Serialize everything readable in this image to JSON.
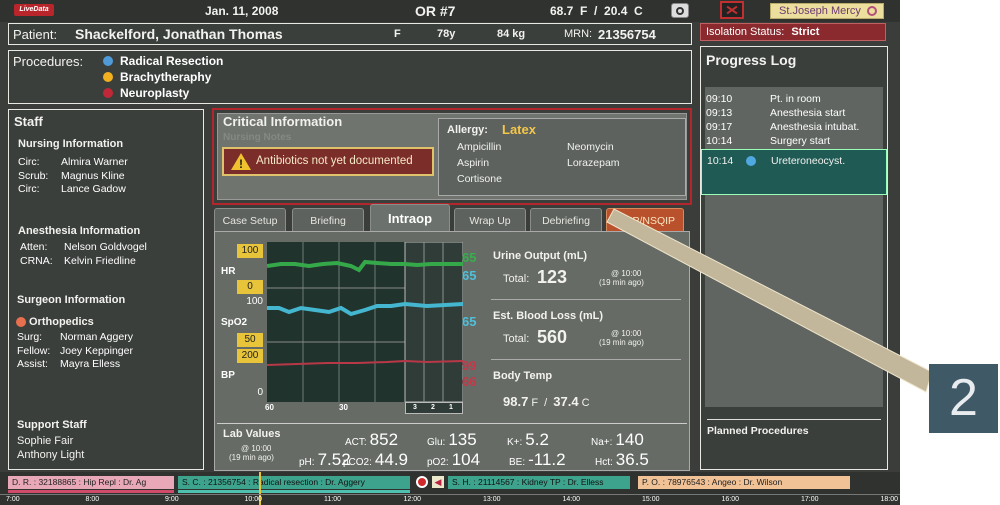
{
  "header": {
    "logo": "LiveData",
    "date": "Jan. 11, 2008",
    "room": "OR #7",
    "temp": "68.7  F  /  20.4  C",
    "hospital": "St.Joseph Mercy"
  },
  "patient": {
    "label": "Patient:",
    "name": "Shackelford, Jonathan Thomas",
    "sex": "F",
    "age": "78y",
    "weight": "84 kg",
    "mrn_label": "MRN:",
    "mrn": "21356754"
  },
  "isolation": {
    "label": "Isolation Status:",
    "value": "Strict"
  },
  "procedures": {
    "label": "Procedures:",
    "items": [
      {
        "name": "Radical Resection",
        "color": "#4f9bd8"
      },
      {
        "name": "Brachytheraphy",
        "color": "#f0b020"
      },
      {
        "name": "Neuroplasty",
        "color": "#c02838"
      }
    ]
  },
  "staff": {
    "title": "Staff",
    "nursing": {
      "title": "Nursing Information",
      "rows": [
        [
          "Circ:",
          "Almira Warner"
        ],
        [
          "Scrub:",
          "Magnus Kline"
        ],
        [
          "Circ:",
          "Lance Gadow"
        ]
      ]
    },
    "anesthesia": {
      "title": "Anesthesia Information",
      "rows": [
        [
          "Atten:",
          "Nelson Goldvogel"
        ],
        [
          "CRNA:",
          "Kelvin Friedline"
        ]
      ]
    },
    "surgeon": {
      "title": "Surgeon Information",
      "specialty": "Orthopedics",
      "rows": [
        [
          "Surg:",
          "Norman Aggery"
        ],
        [
          "Fellow:",
          "Joey Keppinger"
        ],
        [
          "Assist:",
          "Mayra Elless"
        ]
      ]
    },
    "support": {
      "title": "Support Staff",
      "names": [
        "Sophie Fair",
        "Anthony Light"
      ]
    }
  },
  "critical": {
    "title": "Critical Information",
    "nursing_notes": "Nursing Notes",
    "alert": "Antibiotics not yet documented",
    "allergy_label": "Allergy:",
    "allergy_value": "Latex",
    "allergies": [
      "Ampicillin",
      "Neomycin",
      "Aspirin",
      "Lorazepam",
      "Cortisone"
    ]
  },
  "tabs": [
    "Case Setup",
    "Briefing",
    "Intraop",
    "Wrap Up",
    "Debriefing",
    "SCIP/NSQIP"
  ],
  "vitals": {
    "hr": {
      "label": "HR",
      "top": "100",
      "bottom": "0",
      "values": [
        "65",
        "65"
      ]
    },
    "spo2": {
      "label": "SpO2",
      "top": "100",
      "bottom": "50",
      "value": "65"
    },
    "bp": {
      "label": "BP",
      "top": "200",
      "bottom": "0",
      "values": [
        "99",
        "66"
      ]
    },
    "xticks": [
      "60",
      "30",
      "3",
      "2",
      "1"
    ]
  },
  "output": {
    "urine": {
      "title": "Urine Output (mL)",
      "total_label": "Total:",
      "value": "123",
      "time": "@ 10:00",
      "ago": "(19 min ago)"
    },
    "blood": {
      "title": "Est. Blood Loss (mL)",
      "total_label": "Total:",
      "value": "560",
      "time": "@ 10:00",
      "ago": "(19 min ago)"
    },
    "temp": {
      "title": "Body Temp",
      "f": "98.7",
      "f_unit": "F",
      "sep": "/",
      "c": "37.4",
      "c_unit": "C"
    }
  },
  "labs": {
    "title": "Lab Values",
    "time": "@ 10:00",
    "ago": "(19 min ago)",
    "items": [
      {
        "k": "ACT:",
        "v": "852"
      },
      {
        "k": "Glu:",
        "v": "135"
      },
      {
        "k": "K+:",
        "v": "5.2"
      },
      {
        "k": "Na+:",
        "v": "140"
      },
      {
        "k": "pH:",
        "v": "7.52"
      },
      {
        "k": "pCO2:",
        "v": "44.9"
      },
      {
        "k": "pO2:",
        "v": "104"
      },
      {
        "k": "BE:",
        "v": "-11.2"
      },
      {
        "k": "Hct:",
        "v": "36.5"
      }
    ]
  },
  "progress": {
    "title": "Progress Log",
    "entries": [
      {
        "t": "09:10",
        "e": "Pt. in room"
      },
      {
        "t": "09:13",
        "e": "Anesthesia start"
      },
      {
        "t": "09:17",
        "e": "Anesthesia intubat."
      },
      {
        "t": "10:14",
        "e": "Surgery start"
      }
    ],
    "current": {
      "t": "10:14",
      "e": "Ureteroneocyst."
    },
    "planned": "Planned Procedures"
  },
  "timeline": {
    "cases": [
      "D. R. : 32188865 : Hip Repl : Dr. Ag",
      "S. C. : 21356754 : Radical resection : Dr. Aggery",
      "S. H. : 21114567 : Kidney TP : Dr. Elless",
      "P. O. : 78976543 : Angeo : Dr. Wilson"
    ],
    "hours": [
      "7:00",
      "8:00",
      "9:00",
      "10:00",
      "11:00",
      "12:00",
      "13:00",
      "14:00",
      "15:00",
      "16:00",
      "17:00",
      "18:00"
    ]
  },
  "callout": "2"
}
